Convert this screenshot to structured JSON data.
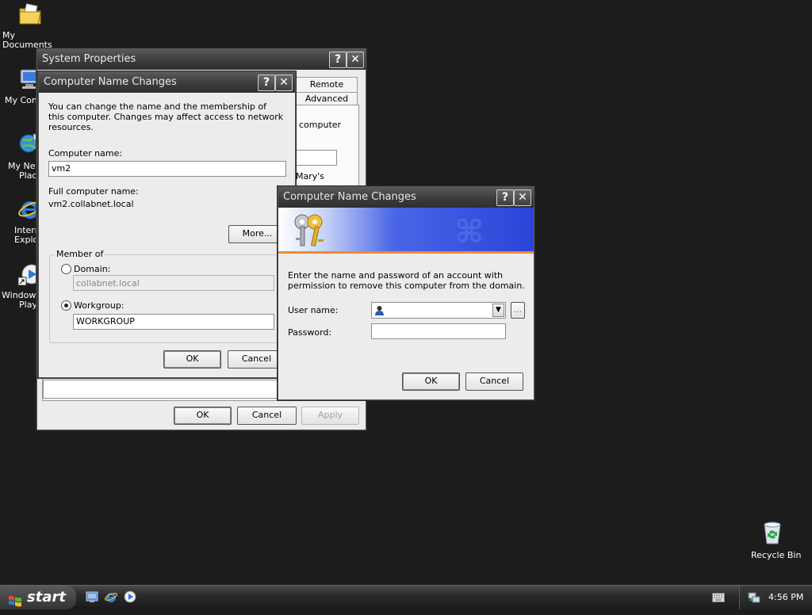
{
  "desktop": {
    "icons": [
      {
        "label": "My Documents",
        "icon": "my-documents-icon"
      },
      {
        "label": "My Comp",
        "icon": "my-computer-icon"
      },
      {
        "label": "My Net",
        "label2": "Plac",
        "icon": "my-network-places-icon"
      },
      {
        "label": "Intern",
        "label2": "Explo",
        "icon": "internet-explorer-icon"
      },
      {
        "label": "Windows",
        "label2": "Play",
        "icon": "windows-media-player-icon"
      },
      {
        "label": "Recycle Bin",
        "icon": "recycle-bin-icon"
      }
    ]
  },
  "system_properties": {
    "title": "System Properties",
    "tabs": [
      "Remote",
      "Advanced"
    ],
    "partial_text": [
      "computer",
      "Mary's"
    ],
    "ok": "OK",
    "cancel": "Cancel",
    "apply": "Apply"
  },
  "name_changes": {
    "title": "Computer Name Changes",
    "description": "You can change the name and the membership of this computer. Changes may affect access to network resources.",
    "computer_name_label": "Computer name:",
    "computer_name_value": "vm2",
    "full_name_label": "Full computer name:",
    "full_name_value": "vm2.collabnet.local",
    "more_button": "More...",
    "member_of_label": "Member of",
    "domain_label": "Domain:",
    "domain_value": "collabnet.local",
    "workgroup_label": "Workgroup:",
    "workgroup_value": "WORKGROUP",
    "selected_membership": "workgroup",
    "ok": "OK",
    "cancel": "Cancel"
  },
  "credentials": {
    "title": "Computer Name Changes",
    "description": "Enter the name and password of an account with permission to remove this computer from the domain.",
    "username_label": "User name:",
    "username_value": "",
    "browse_button": "...",
    "password_label": "Password:",
    "password_value": "",
    "ok": "OK",
    "cancel": "Cancel"
  },
  "taskbar": {
    "start_label": "start",
    "quick_launch": [
      "show-desktop-icon",
      "internet-explorer-icon",
      "windows-media-player-icon"
    ],
    "clock": "4:56 PM"
  },
  "colors": {
    "desktop": "#1c1c1c",
    "titlebar": "#3c3c3c",
    "banner_blue": "#2a44d8",
    "dialog_face": "#ececec"
  }
}
